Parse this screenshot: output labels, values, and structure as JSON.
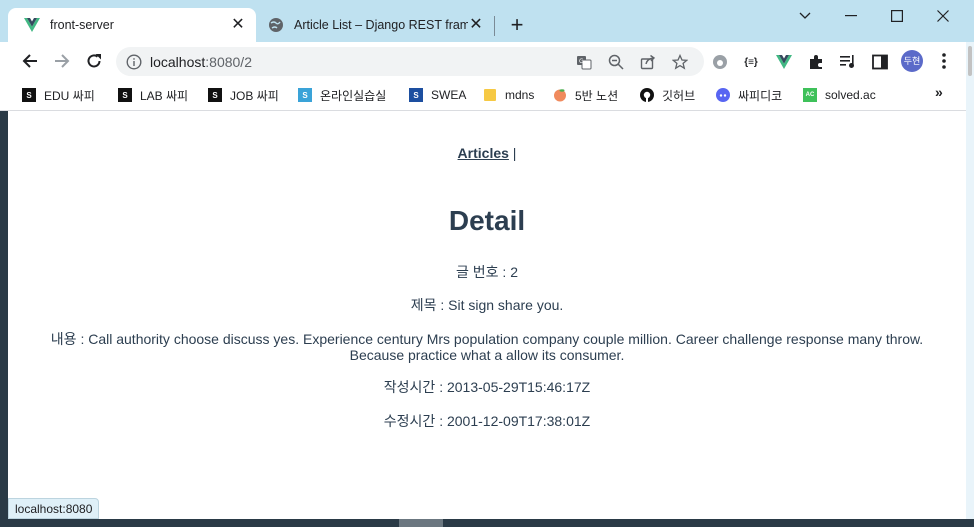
{
  "browser": {
    "tabs": [
      {
        "title": "front-server",
        "active": true
      },
      {
        "title": "Article List – Django REST framewo",
        "active": false
      }
    ],
    "new_tab": "+",
    "window_controls": [
      "chevron-down",
      "minimize",
      "maximize",
      "close"
    ],
    "address": {
      "host": "localhost",
      "path": ":8080/2"
    },
    "profile_initials": "두현",
    "ext_label": "{≡}",
    "bookmarks": [
      {
        "label": "EDU 싸피",
        "icon": "ssafy-icon"
      },
      {
        "label": "LAB 싸피",
        "icon": "ssafy-icon"
      },
      {
        "label": "JOB 싸피",
        "icon": "ssafy-icon"
      },
      {
        "label": "온라인실습실",
        "icon": "ssafy-icon"
      },
      {
        "label": "SWEA",
        "icon": "swea-icon"
      },
      {
        "label": "mdns",
        "icon": "folder-icon"
      },
      {
        "label": "5반 노션",
        "icon": "peach-icon"
      },
      {
        "label": "깃허브",
        "icon": "github-icon"
      },
      {
        "label": "싸피디코",
        "icon": "discord-icon"
      },
      {
        "label": "solved.ac",
        "icon": "solvedac-icon"
      }
    ],
    "bookmarks_more": "»",
    "status_text": "localhost:8080",
    "colors": {
      "tabstrip": "#bfe1f0",
      "vue_green": "#41b883",
      "text": "#2c3e50"
    }
  },
  "page": {
    "nav": {
      "articles_link": "Articles",
      "separator": "|"
    },
    "heading": "Detail",
    "article": {
      "id_label": "글 번호 : 2",
      "title_label": "제목 : Sit sign share you.",
      "content_label": "내용 : Call authority choose discuss yes. Experience century Mrs population company couple million. Career challenge response many throw. Because practice what a allow its consumer.",
      "created_label": "작성시간 : 2013-05-29T15:46:17Z",
      "updated_label": "수정시간 : 2001-12-09T17:38:01Z"
    }
  }
}
